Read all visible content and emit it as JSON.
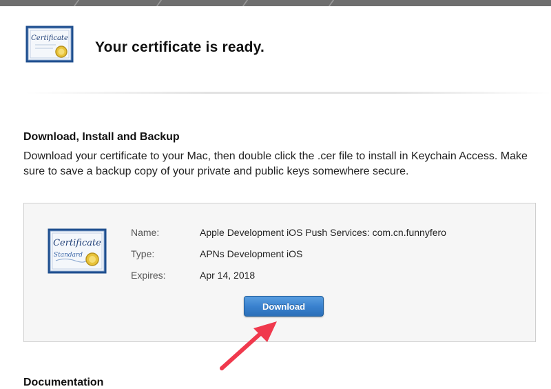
{
  "header": {
    "title": "Your certificate is ready.",
    "icon": "certificate-icon",
    "icon_text": "Certificate"
  },
  "section": {
    "heading": "Download, Install and Backup",
    "description": "Download your certificate to your Mac, then double click the .cer file to install in Keychain Access. Make sure to save a backup copy of your private and public keys somewhere secure."
  },
  "certificate": {
    "icon": "certificate-standard-icon",
    "icon_title": "Certificate",
    "icon_subtitle": "Standard",
    "fields": [
      {
        "label": "Name:",
        "value": "Apple Development iOS Push Services: com.cn.funnyfero"
      },
      {
        "label": "Type:",
        "value": "APNs Development iOS"
      },
      {
        "label": "Expires:",
        "value": "Apr 14, 2018"
      }
    ],
    "download_label": "Download"
  },
  "annotation": {
    "icon": "red-arrow-icon",
    "color": "#f0394d"
  },
  "next_section": {
    "heading": "Documentation"
  },
  "colors": {
    "button_blue": "#3a82cf",
    "card_background": "#f6f6f6"
  }
}
